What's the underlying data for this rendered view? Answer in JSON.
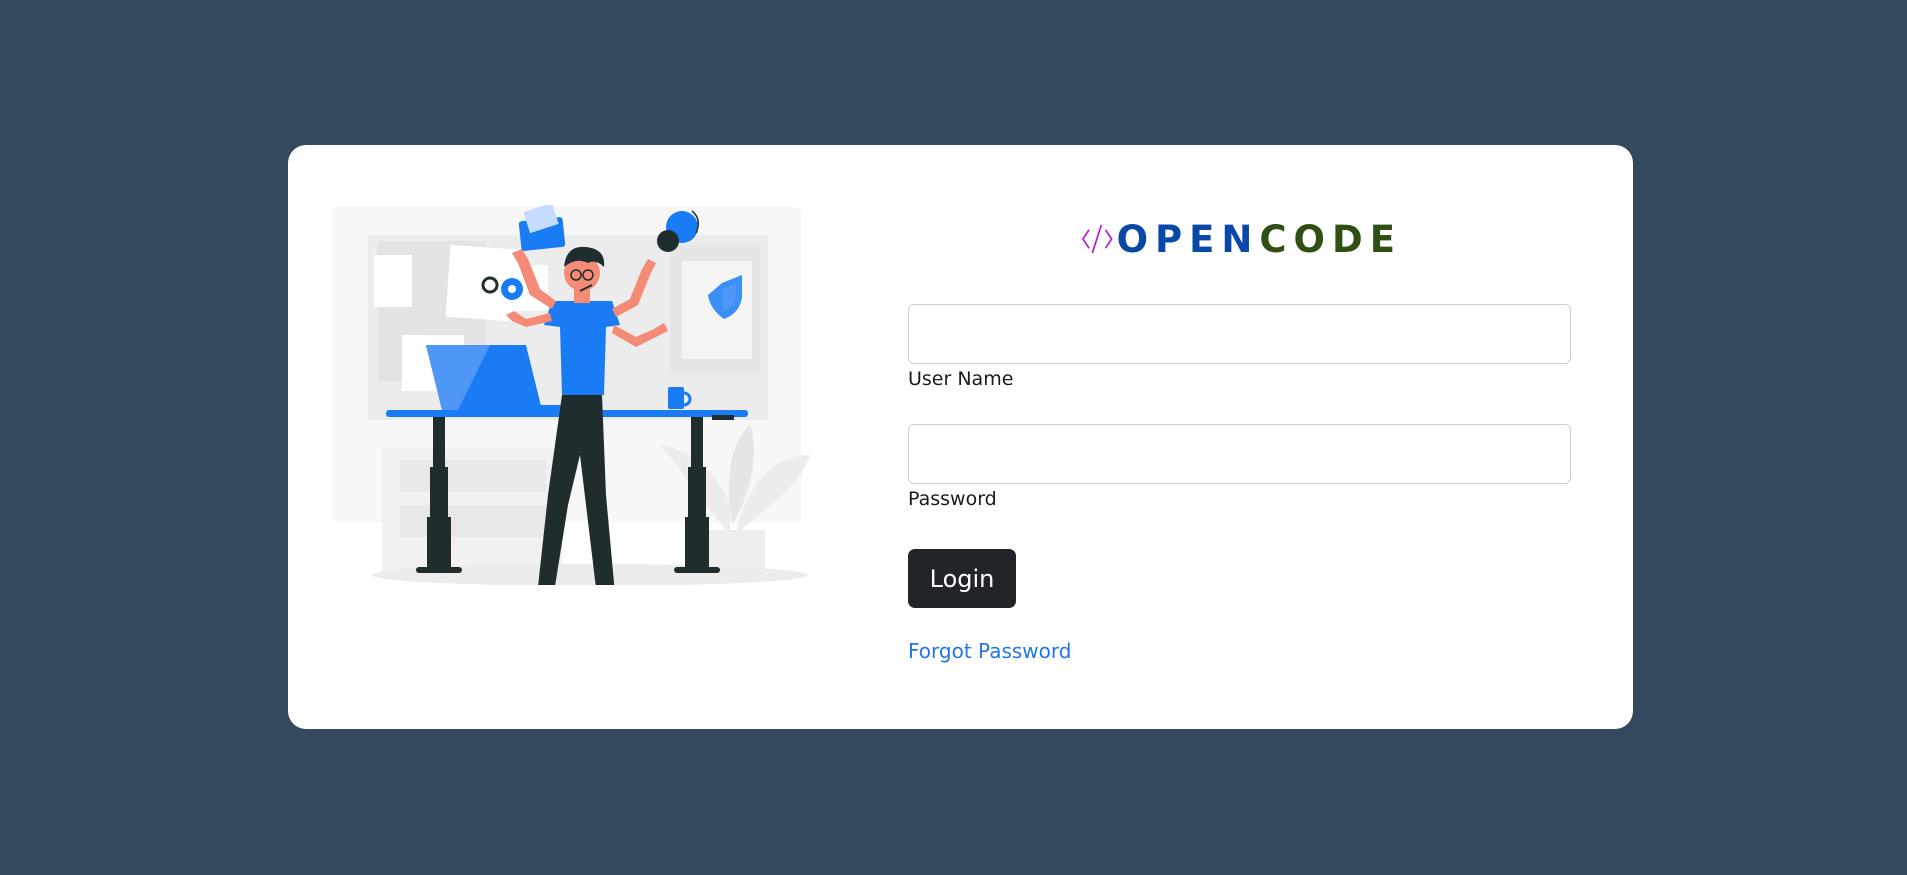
{
  "brand": {
    "logo_text_open": "OPEN",
    "logo_text_code": "CODE",
    "logo_icon": "code-brackets-icon",
    "colors": {
      "open": "#0a48a8",
      "code": "#2f4f14",
      "mark": "#b31ad6"
    }
  },
  "form": {
    "username_label": "User Name",
    "username_value": "",
    "password_label": "Password",
    "password_value": "",
    "login_label": "Login",
    "forgot_label": "Forgot Password"
  },
  "colors": {
    "background": "#34495e",
    "card": "#ffffff",
    "button": "#212529",
    "link": "#2176e8",
    "accent_blue": "#1a7cf5"
  },
  "illustration": {
    "name": "multitasking-person-illustration"
  }
}
